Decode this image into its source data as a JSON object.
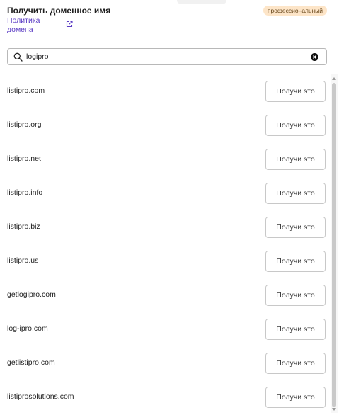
{
  "header": {
    "title": "Получить доменное имя",
    "policy_link": "Политика домена",
    "badge": "профессиональный"
  },
  "search": {
    "value": "logipro",
    "icon": "search-icon",
    "clear_icon": "clear-icon"
  },
  "results": [
    {
      "domain": "listipro.com",
      "button": "Получи это"
    },
    {
      "domain": "listipro.org",
      "button": "Получи это"
    },
    {
      "domain": "listipro.net",
      "button": "Получи это"
    },
    {
      "domain": "listipro.info",
      "button": "Получи это"
    },
    {
      "domain": "listipro.biz",
      "button": "Получи это"
    },
    {
      "domain": "listipro.us",
      "button": "Получи это"
    },
    {
      "domain": "getlogipro.com",
      "button": "Получи это"
    },
    {
      "domain": "log-ipro.com",
      "button": "Получи это"
    },
    {
      "domain": "getlistipro.com",
      "button": "Получи это"
    },
    {
      "domain": "listiprosolutions.com",
      "button": "Получи это"
    }
  ],
  "colors": {
    "link": "#5b3cc4",
    "badge_bg": "#fde5c8",
    "badge_text": "#6b4a1e"
  }
}
